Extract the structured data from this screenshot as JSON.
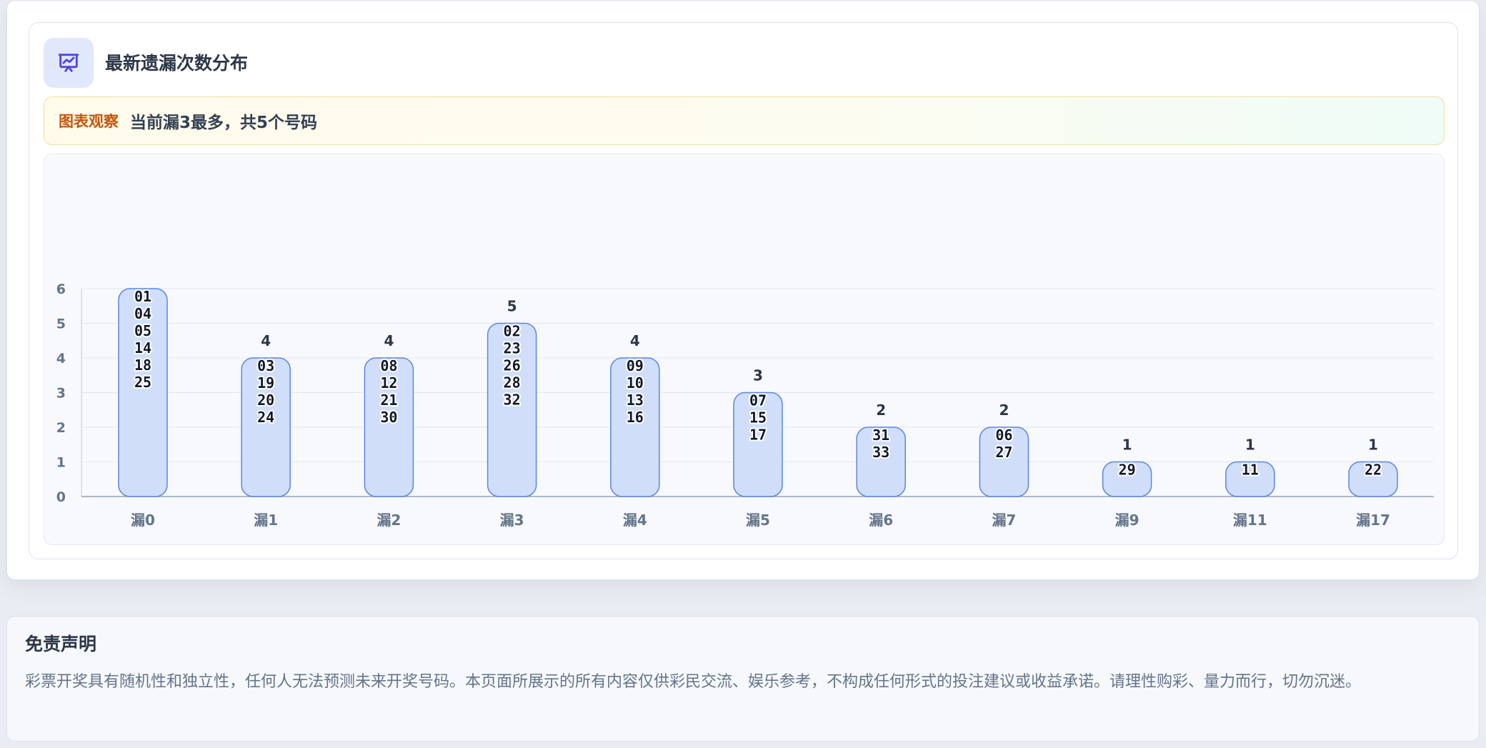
{
  "card": {
    "title": "最新遗漏次数分布",
    "icon": "presentation-chart-icon",
    "accent_color": "#4f46e5"
  },
  "insight": {
    "tag": "图表观察",
    "text": "当前漏3最多，共5个号码"
  },
  "chart_data": {
    "type": "bar",
    "title": "",
    "xlabel": "",
    "ylabel": "",
    "ylim": [
      0,
      6
    ],
    "yticks": [
      0,
      1,
      2,
      3,
      4,
      5,
      6
    ],
    "grid": true,
    "bar_color": "#d0defa",
    "bar_border_color": "#5b86e0",
    "categories": [
      "漏0",
      "漏1",
      "漏2",
      "漏3",
      "漏4",
      "漏5",
      "漏6",
      "漏7",
      "漏9",
      "漏11",
      "漏17"
    ],
    "values": [
      6,
      4,
      4,
      5,
      4,
      3,
      2,
      2,
      1,
      1,
      1
    ],
    "value_labels": [
      "",
      "4",
      "4",
      "5",
      "4",
      "3",
      "2",
      "2",
      "1",
      "1",
      "1"
    ],
    "numbers": [
      [
        "01",
        "04",
        "05",
        "14",
        "18",
        "25"
      ],
      [
        "03",
        "19",
        "20",
        "24"
      ],
      [
        "08",
        "12",
        "21",
        "30"
      ],
      [
        "02",
        "23",
        "26",
        "28",
        "32"
      ],
      [
        "09",
        "10",
        "13",
        "16"
      ],
      [
        "07",
        "15",
        "17"
      ],
      [
        "31",
        "33"
      ],
      [
        "06",
        "27"
      ],
      [
        "29"
      ],
      [
        "11"
      ],
      [
        "22"
      ]
    ]
  },
  "disclaimer": {
    "title": "免责声明",
    "text": "彩票开奖具有随机性和独立性，任何人无法预测未来开奖号码。本页面所展示的所有内容仅供彩民交流、娱乐参考，不构成任何形式的投注建议或收益承诺。请理性购彩、量力而行，切勿沉迷。"
  }
}
